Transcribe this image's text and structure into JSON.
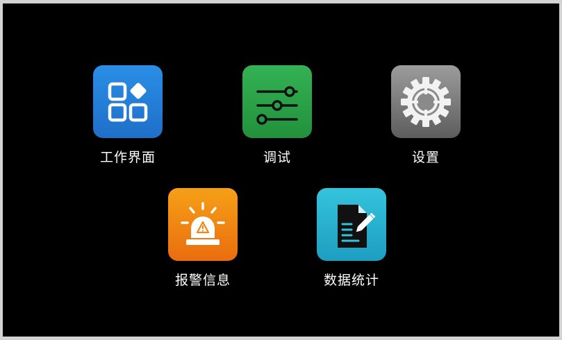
{
  "screen": {
    "tiles": [
      {
        "label": "工作界面",
        "icon": "app-grid-icon",
        "color": "#2a8ee6"
      },
      {
        "label": "调试",
        "icon": "sliders-icon",
        "color": "#2aa047"
      },
      {
        "label": "设置",
        "icon": "gear-icon",
        "color": "#7a7a7a"
      },
      {
        "label": "报警信息",
        "icon": "alarm-siren-icon",
        "color": "#f08513"
      },
      {
        "label": "数据统计",
        "icon": "document-edit-icon",
        "color": "#2ab4d0"
      }
    ]
  }
}
